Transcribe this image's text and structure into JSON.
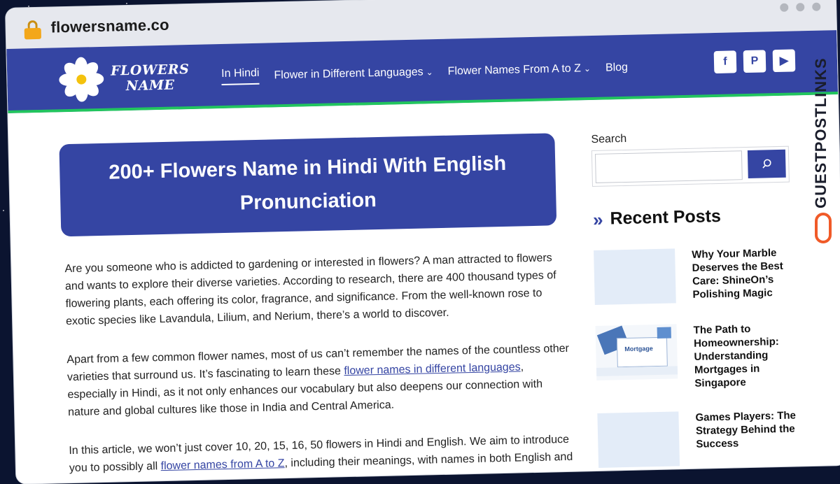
{
  "browser": {
    "url": "flowersname.co",
    "window_dots": [
      "dot",
      "dot",
      "dot"
    ]
  },
  "site": {
    "logo_text_line1": "FLOWERS",
    "logo_text_line2": "NAME",
    "nav": [
      {
        "label": "In Hindi",
        "dropdown": false,
        "active": true
      },
      {
        "label": "Flower in Different Languages",
        "dropdown": true,
        "active": false
      },
      {
        "label": "Flower Names From A to Z",
        "dropdown": true,
        "active": false
      },
      {
        "label": "Blog",
        "dropdown": false,
        "active": false
      }
    ],
    "socials": [
      "facebook-icon",
      "pinterest-icon",
      "youtube-icon"
    ],
    "socials_glyphs": [
      "f",
      "P",
      "▶"
    ],
    "accent": "#3545a3",
    "nav_underline_color": "#22c55e"
  },
  "article": {
    "title": "200+ Flowers Name in Hindi With English Pronunciation",
    "p1": "Are you someone who is addicted to gardening or interested in flowers? A man attracted to flowers and wants to explore their diverse varieties. According to research, there are 400 thousand types of flowering plants, each offering its color, fragrance, and significance. From the well-known rose to exotic species like Lavandula, Lilium, and Nerium, there’s a world to discover.",
    "p2_before": "Apart from a few common flower names, most of us can’t remember the names of the countless other varieties that surround us. It’s fascinating to learn these ",
    "p2_link": "flower names in different languages",
    "p2_after": ", especially in Hindi, as it not only enhances our vocabulary but also deepens our connection with nature and global cultures like those in India and Central America.",
    "p3_before": "In this article, we won’t just cover 10, 20, 15, 16, 50 flowers in Hindi and English. We aim to introduce you to possibly all ",
    "p3_link": "flower names from A to Z",
    "p3_after": ", including their meanings, with names in both English and"
  },
  "sidebar": {
    "search_label": "Search",
    "search_placeholder": "",
    "recent_title": "Recent Posts",
    "recent_icon": "»",
    "posts": [
      {
        "title": "Why Your Marble Deserves the Best Care: ShineOn’s Polishing Magic",
        "thumb": "placeholder"
      },
      {
        "title": "The Path to Homeownership: Understanding Mortgages in Singapore",
        "thumb": "image",
        "thumb_text": "Mortgage"
      },
      {
        "title": "Games Players: The Strategy Behind the Success",
        "thumb": "placeholder"
      }
    ]
  },
  "banner": {
    "text": "GUESTPOSTLINKS"
  }
}
